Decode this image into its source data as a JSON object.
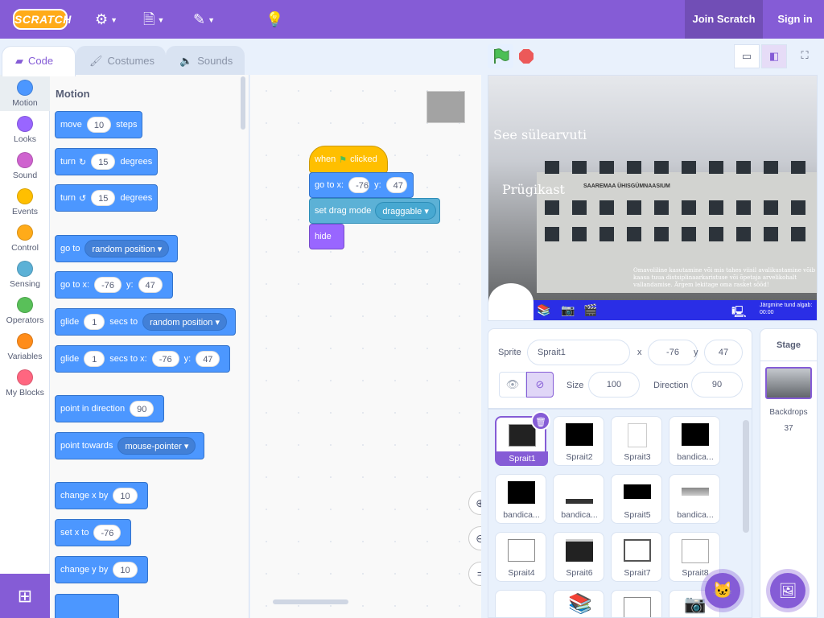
{
  "menubar": {
    "logo": "SCRATCH",
    "join_label": "Join Scratch",
    "signin_label": "Sign in"
  },
  "tabs": [
    {
      "label": "Code",
      "icon": "code-icon"
    },
    {
      "label": "Costumes",
      "icon": "brush-icon"
    },
    {
      "label": "Sounds",
      "icon": "speaker-icon"
    }
  ],
  "categories": [
    {
      "label": "Motion",
      "color": "#4c97ff"
    },
    {
      "label": "Looks",
      "color": "#9966ff"
    },
    {
      "label": "Sound",
      "color": "#cf63cf"
    },
    {
      "label": "Events",
      "color": "#ffbf00"
    },
    {
      "label": "Control",
      "color": "#ffab19"
    },
    {
      "label": "Sensing",
      "color": "#5cb1d6"
    },
    {
      "label": "Operators",
      "color": "#59c059"
    },
    {
      "label": "Variables",
      "color": "#ff8c1a"
    },
    {
      "label": "My Blocks",
      "color": "#ff6680"
    }
  ],
  "palette": {
    "title": "Motion",
    "move": {
      "a": "move",
      "v": "10",
      "b": "steps"
    },
    "turn_right": {
      "a": "turn",
      "v": "15",
      "b": "degrees"
    },
    "turn_left": {
      "a": "turn",
      "v": "15",
      "b": "degrees"
    },
    "goto": {
      "a": "go to",
      "dd": "random position"
    },
    "goto_xy": {
      "a": "go to x:",
      "x": "-76",
      "yl": "y:",
      "y": "47"
    },
    "glide_to": {
      "a": "glide",
      "v": "1",
      "b": "secs to",
      "dd": "random position"
    },
    "glide_xy": {
      "a": "glide",
      "v": "1",
      "b": "secs to x:",
      "x": "-76",
      "yl": "y:",
      "y": "47"
    },
    "point_dir": {
      "a": "point in direction",
      "v": "90"
    },
    "point_towards": {
      "a": "point towards",
      "dd": "mouse-pointer"
    },
    "change_x": {
      "a": "change x by",
      "v": "10"
    },
    "set_x": {
      "a": "set x to",
      "v": "-76"
    },
    "change_y": {
      "a": "change y by",
      "v": "10"
    }
  },
  "script": {
    "hat": {
      "a": "when",
      "b": "clicked"
    },
    "goto": {
      "a": "go to x:",
      "x": "-76",
      "yl": "y:",
      "y": "47"
    },
    "drag": {
      "a": "set drag mode",
      "dd": "draggable"
    },
    "hide": "hide"
  },
  "stage_view": {
    "text1": "See sülearvuti",
    "text2": "Prügikast",
    "sign": "SAAREMAA ÜHISGÜMNAASIUM",
    "info": "Omavoliline kasutamine või mis tahes viisil avalikustamine võib kaasa tuua distsiplinaarkaristuse või õpetaja arvelikohalt vallandamise. Ärgem lekitage oma rasket sõõd!",
    "next_class": "Järgmine tund algab:",
    "time": "00:00"
  },
  "sprite_info": {
    "sprite_label": "Sprite",
    "sprite_name": "Sprait1",
    "x_label": "x",
    "x": "-76",
    "y_label": "y",
    "y": "47",
    "size_label": "Size",
    "size": "100",
    "direction_label": "Direction",
    "direction": "90"
  },
  "sprites": [
    {
      "name": "Sprait1"
    },
    {
      "name": "Sprait2"
    },
    {
      "name": "Sprait3"
    },
    {
      "name": "bandica..."
    },
    {
      "name": "bandica..."
    },
    {
      "name": "bandica..."
    },
    {
      "name": "Sprait5"
    },
    {
      "name": "bandica..."
    },
    {
      "name": "Sprait4"
    },
    {
      "name": "Sprait6"
    },
    {
      "name": "Sprait7"
    },
    {
      "name": "Sprait8"
    }
  ],
  "stage_pane": {
    "title": "Stage",
    "backdrops_label": "Backdrops",
    "backdrops_count": "37"
  }
}
